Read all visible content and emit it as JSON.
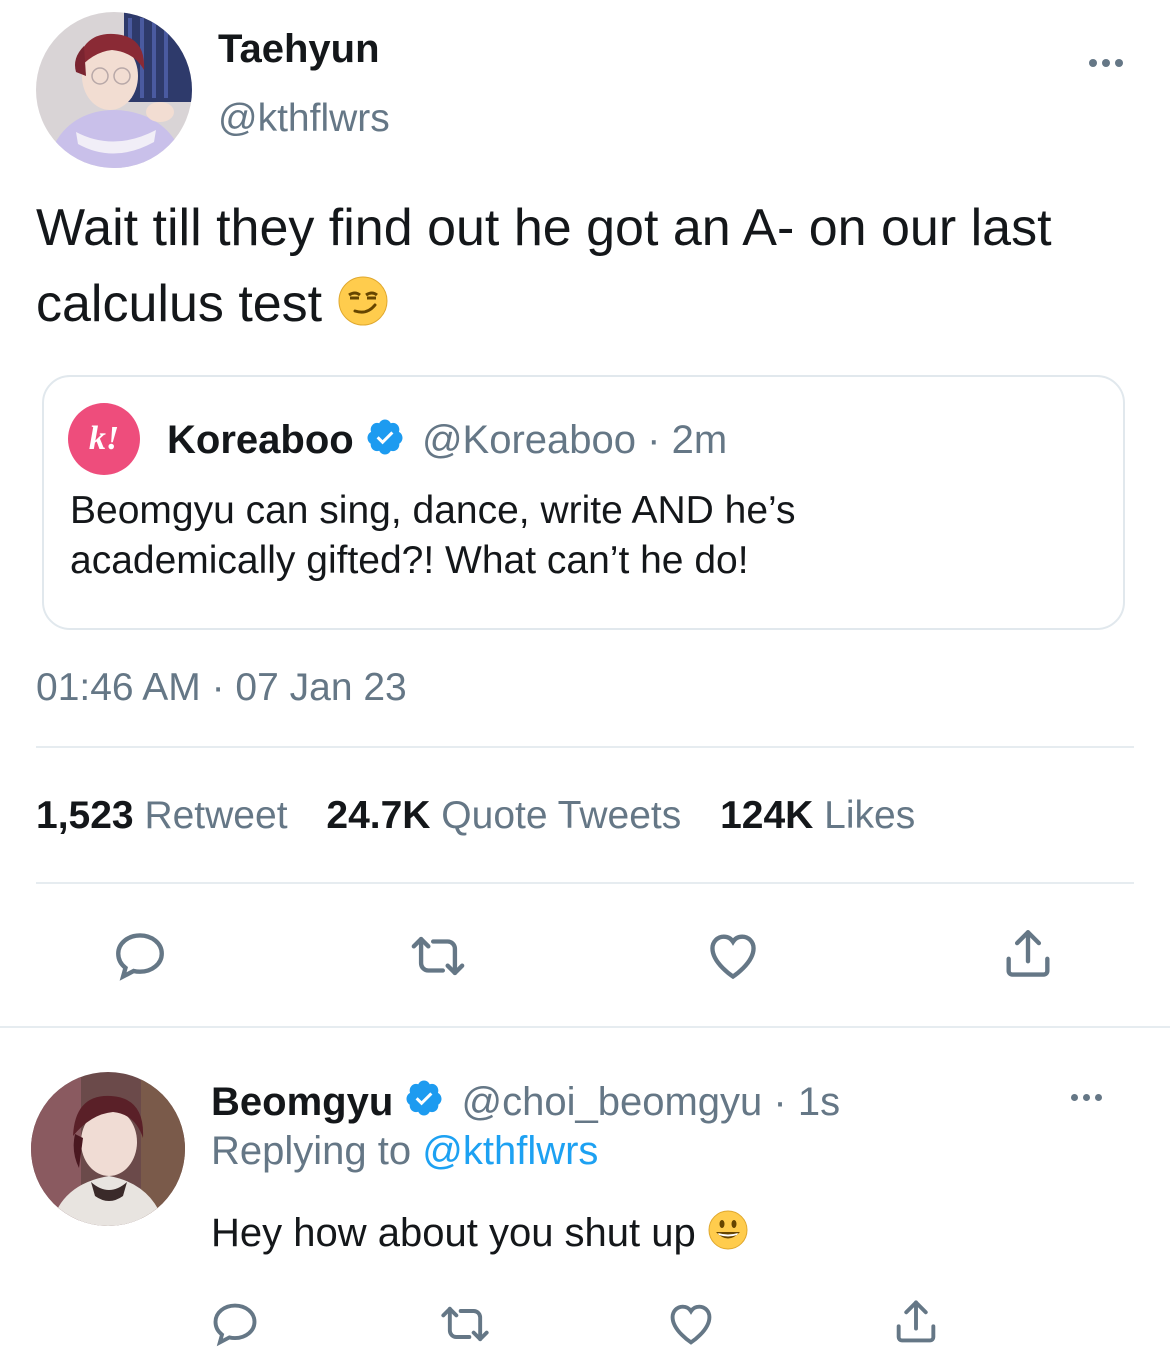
{
  "main_tweet": {
    "author_name": "Taehyun",
    "author_handle": "@kthflwrs",
    "text": "Wait till they find out he got an A- on our last calculus test",
    "emoji": "smirking-face",
    "timestamp": "01:46 AM · 07 Jan 23"
  },
  "quoted_tweet": {
    "author_name": "Koreaboo",
    "author_handle": "@Koreaboo",
    "time": "· 2m",
    "logo_text": "k!",
    "text_line1": "Beomgyu can sing, dance, write AND he’s",
    "text_line2": "academically gifted?! What can’t he do!"
  },
  "stats": [
    {
      "count": "1,523",
      "label": "Retweet"
    },
    {
      "count": "24.7K",
      "label": "Quote Tweets"
    },
    {
      "count": "124K",
      "label": "Likes"
    }
  ],
  "reply": {
    "author_name": "Beomgyu",
    "author_handle": "@choi_beomgyu",
    "time": "· 1s",
    "replying_prefix": "Replying to",
    "replying_handle": "@kthflwrs",
    "text": "Hey how about you shut up",
    "emoji": "grinning-face"
  },
  "colors": {
    "accent": "#1da1f2",
    "muted": "#657786",
    "text": "#14171a",
    "divider": "#e6ecf0",
    "koreaboo_pink": "#ee4d7c",
    "verified": "#1d9bf0"
  }
}
